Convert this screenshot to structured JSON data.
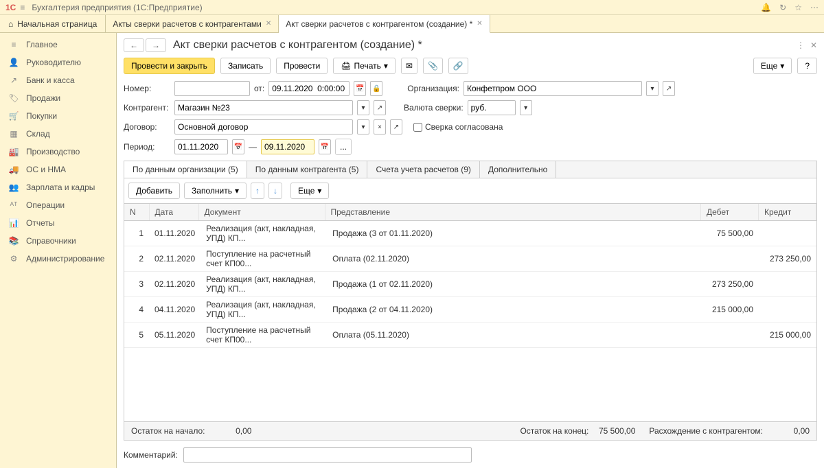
{
  "app": {
    "title": "Бухгалтерия предприятия (1С:Предприятие)"
  },
  "tabs": {
    "home": "Начальная страница",
    "items": [
      {
        "label": "Акты сверки расчетов с контрагентами"
      },
      {
        "label": "Акт сверки расчетов с контрагентом (создание) *"
      }
    ]
  },
  "sidebar": [
    {
      "icon": "≡",
      "label": "Главное"
    },
    {
      "icon": "👤",
      "label": "Руководителю"
    },
    {
      "icon": "↗",
      "label": "Банк и касса"
    },
    {
      "icon": "🏷",
      "label": "Продажи"
    },
    {
      "icon": "🛒",
      "label": "Покупки"
    },
    {
      "icon": "▦",
      "label": "Склад"
    },
    {
      "icon": "🏭",
      "label": "Производство"
    },
    {
      "icon": "🚚",
      "label": "ОС и НМА"
    },
    {
      "icon": "👥",
      "label": "Зарплата и кадры"
    },
    {
      "icon": "ᴬᵀ",
      "label": "Операции"
    },
    {
      "icon": "📊",
      "label": "Отчеты"
    },
    {
      "icon": "📚",
      "label": "Справочники"
    },
    {
      "icon": "⚙",
      "label": "Администрирование"
    }
  ],
  "page": {
    "title": "Акт сверки расчетов с контрагентом (создание) *"
  },
  "toolbar": {
    "primary": "Провести и закрыть",
    "save": "Записать",
    "post": "Провести",
    "print": "Печать",
    "more": "Еще",
    "help": "?"
  },
  "form": {
    "number_label": "Номер:",
    "number": "",
    "from_label": "от:",
    "datetime": "09.11.2020  0:00:00",
    "org_label": "Организация:",
    "org": "Конфетпром ООО",
    "counterparty_label": "Контрагент:",
    "counterparty": "Магазин №23",
    "currency_label": "Валюта сверки:",
    "currency": "руб.",
    "contract_label": "Договор:",
    "contract": "Основной договор",
    "agreed_label": "Сверка согласована",
    "period_label": "Период:",
    "period_from": "01.11.2020",
    "period_to": "09.11.2020",
    "dash": "—",
    "ellipsis": "..."
  },
  "subtabs": [
    "По данным организации (5)",
    "По данным контрагента (5)",
    "Счета учета расчетов (9)",
    "Дополнительно"
  ],
  "innerToolbar": {
    "add": "Добавить",
    "fill": "Заполнить",
    "more": "Еще"
  },
  "columns": [
    "N",
    "Дата",
    "Документ",
    "Представление",
    "Дебет",
    "Кредит"
  ],
  "rows": [
    {
      "n": "1",
      "date": "01.11.2020",
      "doc": "Реализация (акт, накладная, УПД) КП...",
      "repr": "Продажа (3 от 01.11.2020)",
      "debit": "75 500,00",
      "credit": ""
    },
    {
      "n": "2",
      "date": "02.11.2020",
      "doc": "Поступление на расчетный счет КП00...",
      "repr": "Оплата (02.11.2020)",
      "debit": "",
      "credit": "273 250,00"
    },
    {
      "n": "3",
      "date": "02.11.2020",
      "doc": "Реализация (акт, накладная, УПД) КП...",
      "repr": "Продажа (1 от 02.11.2020)",
      "debit": "273 250,00",
      "credit": ""
    },
    {
      "n": "4",
      "date": "04.11.2020",
      "doc": "Реализация (акт, накладная, УПД) КП...",
      "repr": "Продажа (2 от 04.11.2020)",
      "debit": "215 000,00",
      "credit": ""
    },
    {
      "n": "5",
      "date": "05.11.2020",
      "doc": "Поступление на расчетный счет КП00...",
      "repr": "Оплата (05.11.2020)",
      "debit": "",
      "credit": "215 000,00"
    }
  ],
  "footer": {
    "start_label": "Остаток на начало:",
    "start_val": "0,00",
    "end_label": "Остаток на конец:",
    "end_val": "75 500,00",
    "diff_label": "Расхождение с контрагентом:",
    "diff_val": "0,00"
  },
  "comment_label": "Комментарий:",
  "comment": ""
}
